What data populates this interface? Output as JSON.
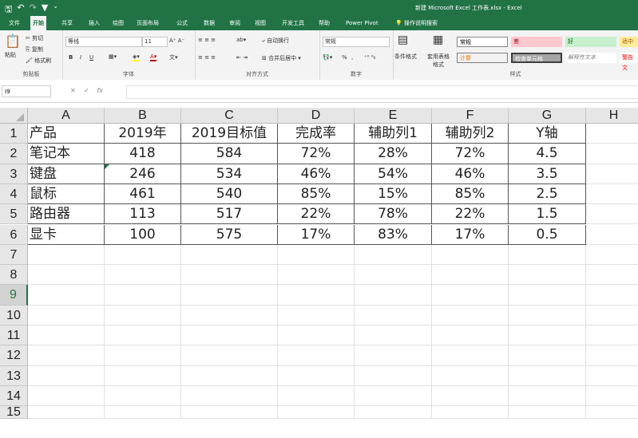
{
  "window": {
    "title": "新建 Microsoft Excel 工作表.xlsx  -  Excel",
    "qa_icons": [
      "save-icon",
      "undo-icon",
      "redo-icon",
      "filter-icon",
      "customize-icon"
    ]
  },
  "tabs": [
    "文件",
    "开始",
    "共享",
    "插入",
    "绘图",
    "页面布局",
    "公式",
    "数据",
    "审阅",
    "视图",
    "开发工具",
    "帮助",
    "Power Pivot",
    "操作说明搜索"
  ],
  "active_tab": "开始",
  "ribbon": {
    "clipboard": {
      "paste": "粘贴",
      "cut": "剪切",
      "copy": "复制",
      "format_painter": "格式刷",
      "label": "剪贴板"
    },
    "font": {
      "name": "等线",
      "size": "11",
      "label": "字体",
      "bold": "B",
      "italic": "I",
      "underline": "U"
    },
    "alignment": {
      "wrap": "自动换行",
      "merge": "合并后居中",
      "label": "对齐方式"
    },
    "number": {
      "format": "常规",
      "label": "数字",
      "percent": "%"
    },
    "styles": {
      "conditional": "条件格式",
      "table": "套用表格格式",
      "label": "样式",
      "cells": [
        {
          "text": "常规",
          "bg": "#ffffff",
          "color": "#000000"
        },
        {
          "text": "差",
          "bg": "#ffc7ce",
          "color": "#9c0006"
        },
        {
          "text": "好",
          "bg": "#c6efce",
          "color": "#006100"
        },
        {
          "text": "适中",
          "bg": "#ffeb9c",
          "color": "#9c5700"
        },
        {
          "text": "计算",
          "bg": "#f2f2f2",
          "color": "#fa7d00"
        },
        {
          "text": "检查单元格",
          "bg": "#a5a5a5",
          "color": "#ffffff"
        },
        {
          "text": "解释性文本",
          "bg": "#ffffff",
          "color": "#7f7f7f"
        },
        {
          "text": "警告文",
          "bg": "#ffffff",
          "color": "#ff0000"
        }
      ]
    }
  },
  "formula_bar": {
    "name_box": "I9",
    "cancel": "✕",
    "enter": "✓",
    "fx": "fx",
    "value": ""
  },
  "columns": [
    "A",
    "B",
    "C",
    "D",
    "E",
    "F",
    "G",
    "H"
  ],
  "rows": [
    "1",
    "2",
    "3",
    "4",
    "5",
    "6",
    "7",
    "8",
    "9",
    "10",
    "11",
    "12",
    "13",
    "14",
    "15"
  ],
  "selected_row": "9",
  "table": {
    "header": [
      "产品",
      "2019年",
      "2019目标值",
      "完成率",
      "辅助列1",
      "辅助列2",
      "Y轴"
    ],
    "data": [
      [
        "笔记本",
        "418",
        "584",
        "72%",
        "28%",
        "72%",
        "4.5"
      ],
      [
        "键盘",
        "246",
        "534",
        "46%",
        "54%",
        "46%",
        "3.5"
      ],
      [
        "鼠标",
        "461",
        "540",
        "85%",
        "15%",
        "85%",
        "2.5"
      ],
      [
        "路由器",
        "113",
        "517",
        "22%",
        "78%",
        "22%",
        "1.5"
      ],
      [
        "显卡",
        "100",
        "575",
        "17%",
        "83%",
        "17%",
        "0.5"
      ]
    ]
  },
  "colors": {
    "accent": "#217346"
  }
}
